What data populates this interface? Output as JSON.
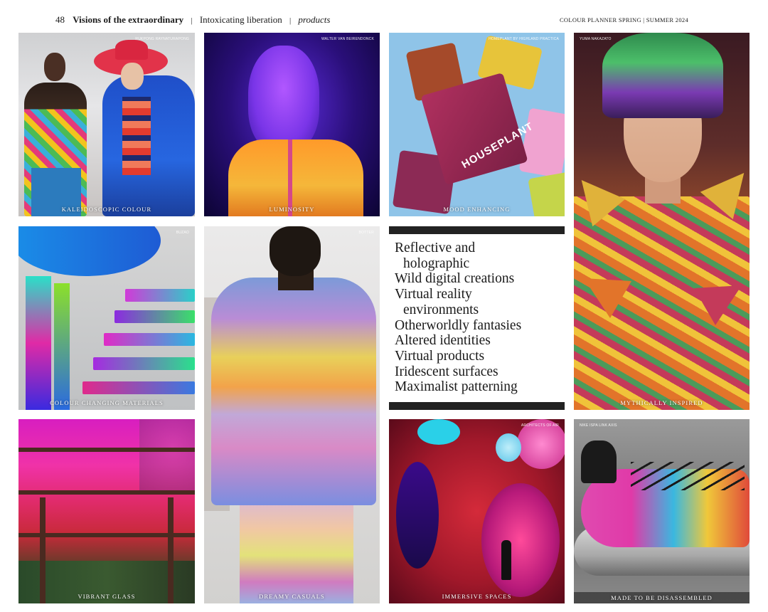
{
  "header": {
    "page_number": "48",
    "title": "Visions of the extraordinary",
    "separator": "|",
    "subtitle": "Intoxicating liberation",
    "section": "products",
    "publication": "COLOUR PLANNER  SPRING | SUMMER 2024"
  },
  "tiles": [
    {
      "caption": "KALEIDOSCOPIC COLOUR",
      "credit": "RUKPONG RAYNATURAPONG"
    },
    {
      "caption": "LUMINOSITY",
      "credit": "WALTER VAN BEIRENDONCK"
    },
    {
      "caption": "MOOD ENHANCING",
      "credit": "HOMEPLANT BY HIGHLAND PRACTICA",
      "product_text": "HOUSEPLANT"
    },
    {
      "caption": "MYTHICALLY INSPIRED",
      "credit": "YUMA NAKAZATO"
    },
    {
      "caption": "COLOUR CHANGING MATERIALS",
      "credit": "BUZAO"
    },
    {
      "caption": "DREAMY CASUALS",
      "credit": "BOTTER"
    },
    {
      "caption": "VIBRANT GLASS",
      "credit": ""
    },
    {
      "caption": "IMMERSIVE SPACES",
      "credit": "ARCHITECTS OF AIR"
    },
    {
      "caption": "MADE TO BE DISASSEMBLED",
      "credit": "NIKE ISPA LINK AXIS"
    }
  ],
  "keywords": [
    {
      "text": "Reflective and",
      "indent": false
    },
    {
      "text": "holographic",
      "indent": true
    },
    {
      "text": "Wild digital creations",
      "indent": false
    },
    {
      "text": "Virtual reality",
      "indent": false
    },
    {
      "text": "environments",
      "indent": true
    },
    {
      "text": "Otherworldly fantasies",
      "indent": false
    },
    {
      "text": "Altered identities",
      "indent": false
    },
    {
      "text": "Virtual products",
      "indent": false
    },
    {
      "text": "Iridescent surfaces",
      "indent": false
    },
    {
      "text": "Maximalist patterning",
      "indent": false
    }
  ]
}
